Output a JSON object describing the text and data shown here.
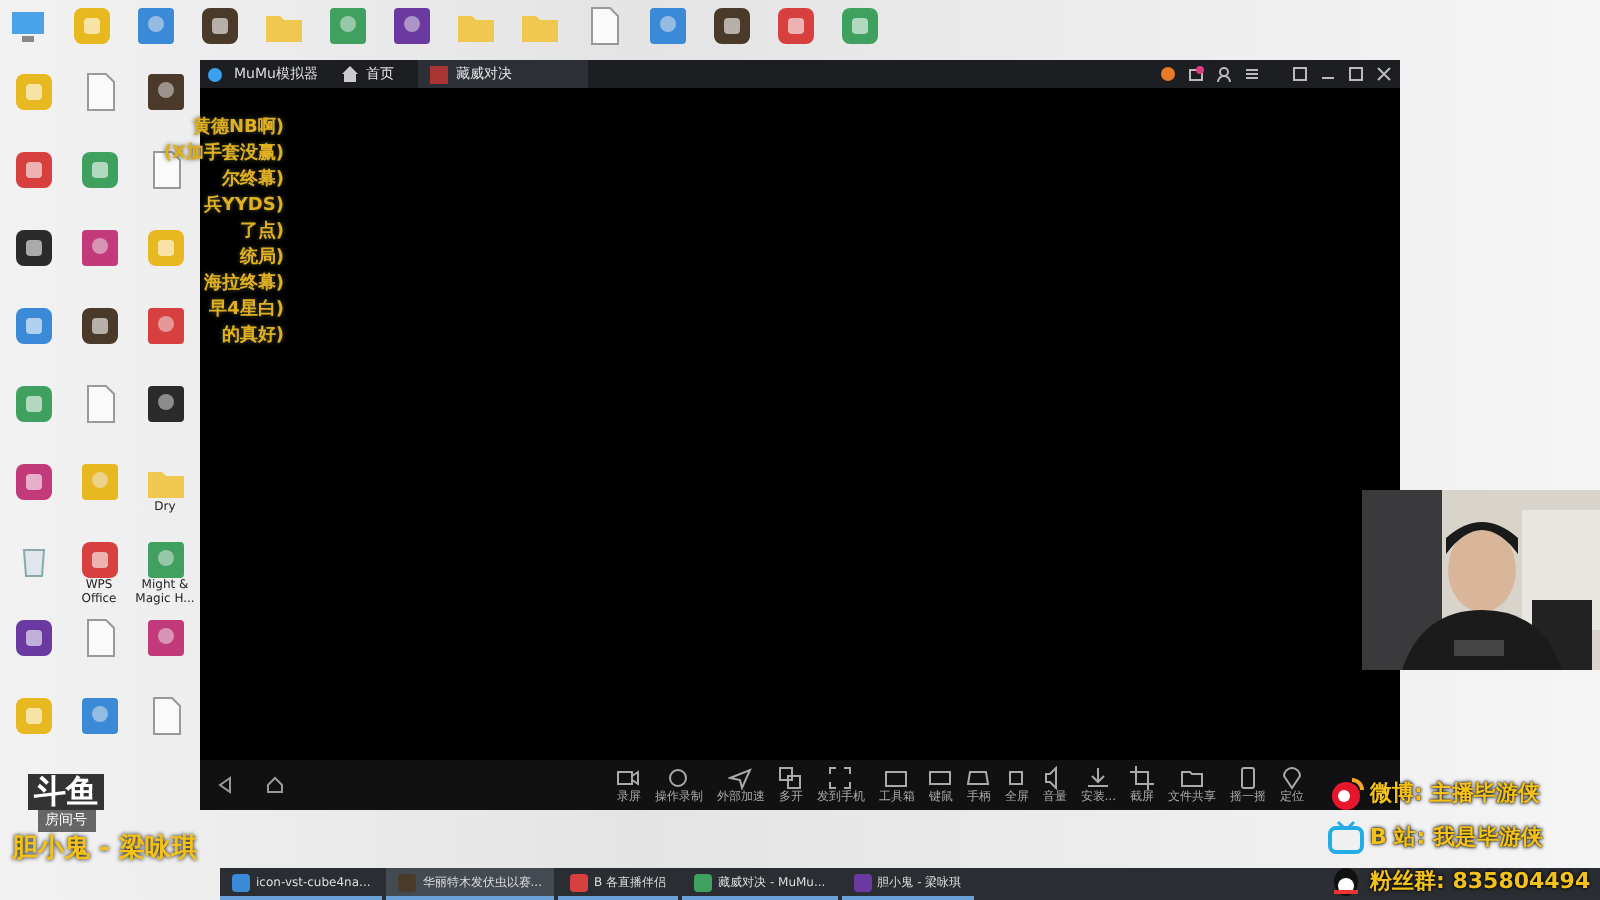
{
  "desktop_top_icons": [
    {
      "kind": "computer"
    },
    {
      "kind": "app"
    },
    {
      "kind": "game"
    },
    {
      "kind": "app"
    },
    {
      "kind": "folder"
    },
    {
      "kind": "game"
    },
    {
      "kind": "game"
    },
    {
      "kind": "folder"
    },
    {
      "kind": "folder"
    },
    {
      "kind": "file"
    },
    {
      "kind": "game"
    },
    {
      "kind": "app"
    },
    {
      "kind": "app"
    },
    {
      "kind": "app"
    }
  ],
  "desktop_left_icons": [
    {
      "kind": "app"
    },
    {
      "kind": "file"
    },
    {
      "kind": "game"
    },
    {
      "kind": "app"
    },
    {
      "kind": "app"
    },
    {
      "kind": "file"
    },
    {
      "kind": "app"
    },
    {
      "kind": "game"
    },
    {
      "kind": "app"
    },
    {
      "kind": "app"
    },
    {
      "kind": "app"
    },
    {
      "kind": "game"
    },
    {
      "kind": "app"
    },
    {
      "kind": "file"
    },
    {
      "kind": "game"
    },
    {
      "kind": "app"
    },
    {
      "kind": "game"
    },
    {
      "kind": "folder",
      "label": "Dry"
    },
    {
      "kind": "bin"
    },
    {
      "kind": "app",
      "label": "WPS Office"
    },
    {
      "kind": "game",
      "label": "Might & Magic H..."
    },
    {
      "kind": "app"
    },
    {
      "kind": "file"
    },
    {
      "kind": "game"
    },
    {
      "kind": "app"
    },
    {
      "kind": "game"
    },
    {
      "kind": "file"
    }
  ],
  "chat_overlay": [
    "黄德NB啊)",
    "(X加手套没赢)",
    "尔终幕)",
    "兵YYDS)",
    "了点)",
    "统局)",
    "海拉终幕)",
    "早4星白)",
    "的真好)"
  ],
  "emulator": {
    "app_name": "MuMu模拟器",
    "home_tab": "首页",
    "tabs": [
      {
        "label": "藏威对决",
        "selected": true
      }
    ],
    "toolbar": [
      {
        "kind": "record",
        "label": "录屏"
      },
      {
        "kind": "macro",
        "label": "操作录制"
      },
      {
        "kind": "speed",
        "label": "外部加速"
      },
      {
        "kind": "multi",
        "label": "多开"
      },
      {
        "kind": "phone",
        "label": "发到手机"
      },
      {
        "kind": "toolbox",
        "label": "工具箱"
      },
      {
        "kind": "keyboard",
        "label": "键鼠"
      },
      {
        "kind": "gamepad",
        "label": "手柄"
      },
      {
        "kind": "fullscreen",
        "label": "全屏"
      },
      {
        "kind": "volume",
        "label": "音量"
      },
      {
        "kind": "install",
        "label": "安装..."
      },
      {
        "kind": "crop",
        "label": "截屏"
      },
      {
        "kind": "folder",
        "label": "文件共享"
      },
      {
        "kind": "shake",
        "label": "摇一摇"
      },
      {
        "kind": "location",
        "label": "定位"
      }
    ]
  },
  "stream_overlay": {
    "logo": "斗鱼",
    "room_label": "房间号",
    "song": "胆小鬼 - 梁咏琪",
    "socials": [
      {
        "kind": "weibo",
        "text": "微博: 主播毕游侠"
      },
      {
        "kind": "bilibili",
        "text": "B 站: 我是毕游侠"
      },
      {
        "kind": "qq",
        "text": "粉丝群: 835804494"
      }
    ]
  },
  "taskbar": [
    {
      "label": "icon-vst-cube4na...",
      "selected": false
    },
    {
      "label": "华丽特木发伏虫以赛...",
      "selected": true
    },
    {
      "label": "B 各直播伴侣",
      "selected": false
    },
    {
      "label": "藏威对决 - MuMu...",
      "selected": false
    },
    {
      "label": "胆小鬼 - 梁咏琪",
      "selected": false
    }
  ]
}
